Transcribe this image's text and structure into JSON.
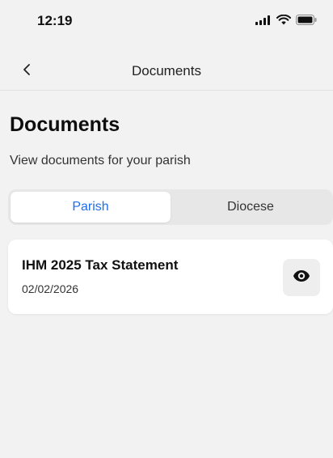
{
  "status_bar": {
    "time": "12:19",
    "icons": [
      "cellular-signal-icon",
      "wifi-icon",
      "battery-icon"
    ]
  },
  "nav": {
    "back_icon": "chevron-left-icon",
    "title": "Documents"
  },
  "header": {
    "title": "Documents",
    "subtitle": "View documents for your parish"
  },
  "tabs": [
    {
      "label": "Parish",
      "active": true
    },
    {
      "label": "Diocese",
      "active": false
    }
  ],
  "documents": [
    {
      "title": "IHM 2025 Tax Statement",
      "date": "02/02/2026",
      "action_icon": "eye-icon"
    }
  ],
  "colors": {
    "accent": "#1f6feb",
    "background": "#f2f2f2",
    "card": "#ffffff"
  }
}
